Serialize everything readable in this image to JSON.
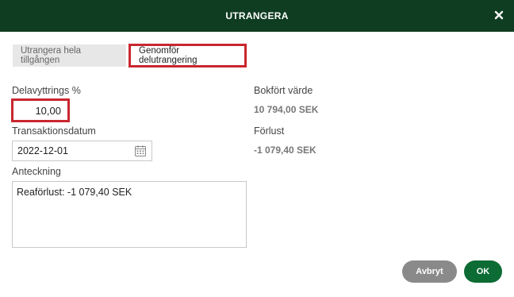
{
  "dialog": {
    "title": "UTRANGERA"
  },
  "tabs": [
    {
      "label": "Utrangera hela tillgången",
      "active": false
    },
    {
      "label": "Genomför delutrangering",
      "active": true
    }
  ],
  "form": {
    "percent_label": "Delavyttrings %",
    "percent_value": "10,00",
    "date_label": "Transaktionsdatum",
    "date_value": "2022-12-01",
    "note_label": "Anteckning",
    "note_value": "Reaförlust: -1 079,40 SEK"
  },
  "summary": {
    "book_value_label": "Bokfört värde",
    "book_value": "10 794,00 SEK",
    "loss_label": "Förlust",
    "loss_value": "-1 079,40 SEK"
  },
  "buttons": {
    "cancel_label": "Avbryt",
    "ok_label": "OK"
  },
  "colors": {
    "header_bg": "#0f3d22",
    "highlight": "#c8272f",
    "ok_button": "#0d6b34",
    "cancel_button": "#8a8a8a"
  },
  "icons": {
    "close": "close-icon",
    "calendar": "calendar-icon"
  }
}
